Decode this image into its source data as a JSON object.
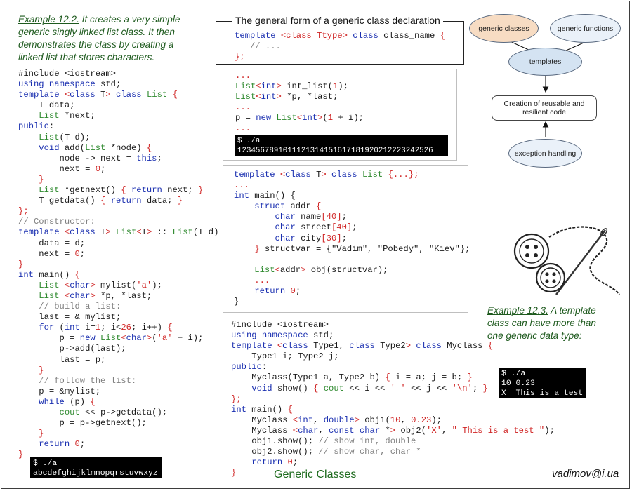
{
  "example_12_2": {
    "label": "Example 12.2.",
    "text": " It creates a very simple generic singly linked list class. It then demonstrates the class by creating a linked list that stores characters."
  },
  "general_form": {
    "title": "The general form of a generic class declaration",
    "line1_kw": "template",
    "line1_tpl": "<class Ttype>",
    "line1_rest_kw": "class",
    "line1_name": " class_name ",
    "line1_brace": "{",
    "line2": "   // ...",
    "line3": "};"
  },
  "snippet_int_list": {
    "terminal_prompt": "$ ./a",
    "terminal_output": "1234567891011121314151617181920212223242526"
  },
  "list_terminal": {
    "prompt": "$ ./a",
    "output": "abcdefghijklmnopqrstuvwxyz"
  },
  "example_12_3": {
    "label": "Example 12.3.",
    "text": " A template class can have more than one generic data type:"
  },
  "myclass_terminal": {
    "line1": "$ ./a",
    "line2": "10 0.23",
    "line3": "X  This is a test"
  },
  "diagram": {
    "generic_classes": "generic classes",
    "generic_functions": "generic functions",
    "templates": "templates",
    "creation": "Creation of reusable and resilient code",
    "exception_handling": "exception handling",
    "colors": {
      "generic_classes_fill": "#f7dcc3",
      "templates_fill": "#d4e3f2",
      "node_fill": "#eaf1f9"
    }
  },
  "footer": {
    "title": "Generic Classes",
    "email": "vadimov@i.ua"
  }
}
